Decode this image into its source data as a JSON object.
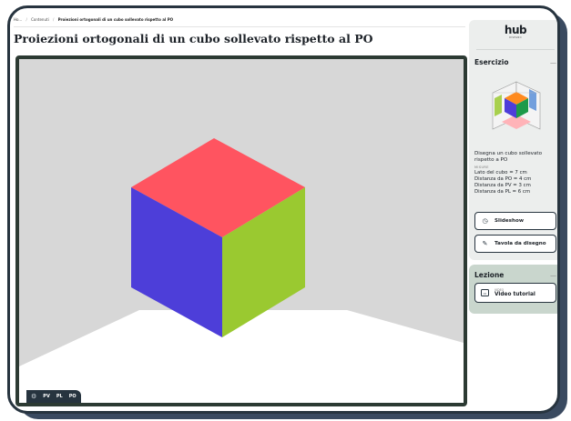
{
  "breadcrumb": {
    "home": "Ho...",
    "contents": "Contenuti",
    "current": "Proiezioni ortogonali di un cubo sollevato rispetto al PO"
  },
  "page_title": "Proiezioni ortogonali di un cubo sollevato rispetto al PO",
  "viewer": {
    "toolbar": {
      "settings_icon": "gear-icon",
      "pv": "PV",
      "pl": "PL",
      "po": "PO"
    },
    "colors": {
      "background": "#d7d7d7",
      "floor": "#ffffff",
      "cube_top": "#ff5460",
      "cube_left": "#4d3ed9",
      "cube_right": "#9ac930",
      "frame": "#2c3a33"
    }
  },
  "sidebar": {
    "logo_text": "hub",
    "logo_sub": "DISEGNO",
    "exercise": {
      "heading": "Esercizio",
      "collapse": "—",
      "description": "Disegna un cubo sollevato rispetto a PO",
      "measures_tag": "MISURE",
      "measures": [
        "Lato del cubo = 7 cm",
        "Distanza da PO = 4 cm",
        "Distanza da PV = 3 cm",
        "Distanza da PL = 6 cm"
      ],
      "buttons": {
        "slideshow": "Slideshow",
        "drawing_board": "Tavola da disegno"
      }
    },
    "lesson": {
      "heading": "Lezione",
      "collapse": "—",
      "video_tag": "VIDEO",
      "video_label": "Video tutorial"
    }
  }
}
